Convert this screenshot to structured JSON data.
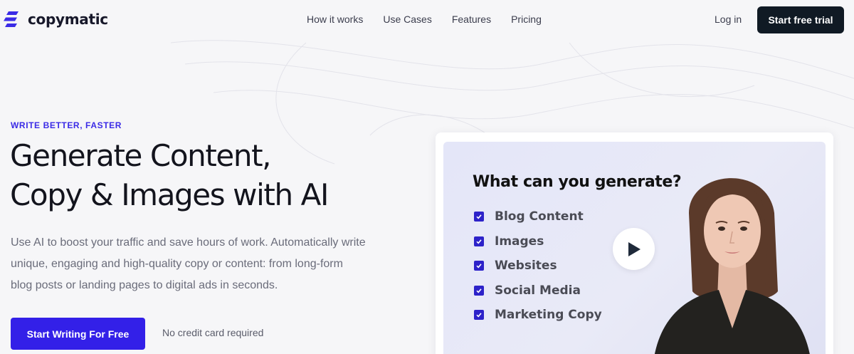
{
  "brand": {
    "name": "copymatic"
  },
  "nav": {
    "links": [
      "How it works",
      "Use Cases",
      "Features",
      "Pricing"
    ],
    "login": "Log in",
    "cta": "Start free trial"
  },
  "hero": {
    "eyebrow": "WRITE BETTER, FASTER",
    "headline_line1": "Generate Content,",
    "headline_line2": "Copy & Images with AI",
    "lead": "Use AI to boost your traffic and save hours of work. Automatically write unique, engaging and high-quality copy or content: from long-form blog posts or landing pages to digital ads in seconds.",
    "cta": "Start Writing For Free",
    "cta_note": "No credit card required"
  },
  "video": {
    "title": "What can you generate?",
    "items": [
      "Blog Content",
      "Images",
      "Websites",
      "Social Media",
      "Marketing Copy"
    ]
  },
  "colors": {
    "accent": "#3320e8",
    "dark": "#101a24",
    "checkbox": "#2d22c9"
  }
}
